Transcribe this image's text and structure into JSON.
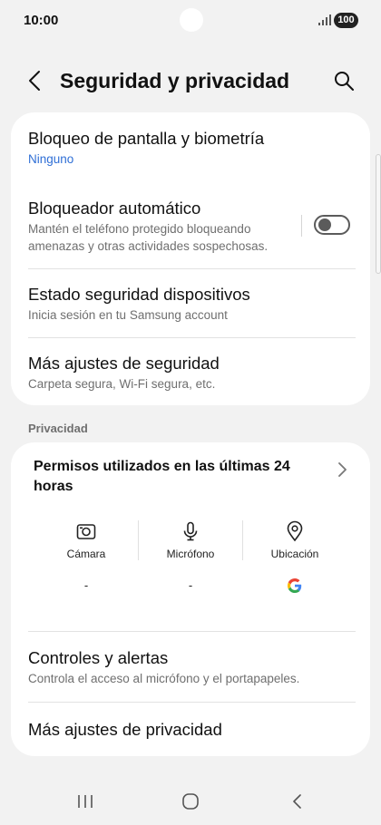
{
  "status": {
    "time": "10:00",
    "battery": "100"
  },
  "header": {
    "title": "Seguridad y privacidad"
  },
  "security": {
    "items": [
      {
        "title": "Bloqueo de pantalla y biometría",
        "subtitle": "Ninguno"
      },
      {
        "title": "Bloqueador automático",
        "subtitle": "Mantén el teléfono protegido bloqueando amenazas y otras actividades sospechosas.",
        "toggle_on": false
      },
      {
        "title": "Estado seguridad dispositivos",
        "subtitle": "Inicia sesión en tu Samsung account"
      },
      {
        "title": "Más ajustes de seguridad",
        "subtitle": "Carpeta segura, Wi-Fi segura, etc."
      }
    ]
  },
  "privacy": {
    "section_label": "Privacidad",
    "permissions_title": "Permisos utilizados en las últimas 24 horas",
    "permissions": [
      {
        "label": "Cámara",
        "icon": "camera-icon",
        "value": "-"
      },
      {
        "label": "Micrófono",
        "icon": "microphone-icon",
        "value": "-"
      },
      {
        "label": "Ubicación",
        "icon": "location-icon",
        "value": "",
        "app_icon": "google-icon"
      }
    ],
    "items": [
      {
        "title": "Controles y alertas",
        "subtitle": "Controla el acceso al micrófono y el portapapeles."
      },
      {
        "title": "Más ajustes de privacidad"
      }
    ]
  },
  "colors": {
    "accent_blue": "#2f6fd6",
    "background": "#f2f2f2",
    "card": "#ffffff"
  }
}
